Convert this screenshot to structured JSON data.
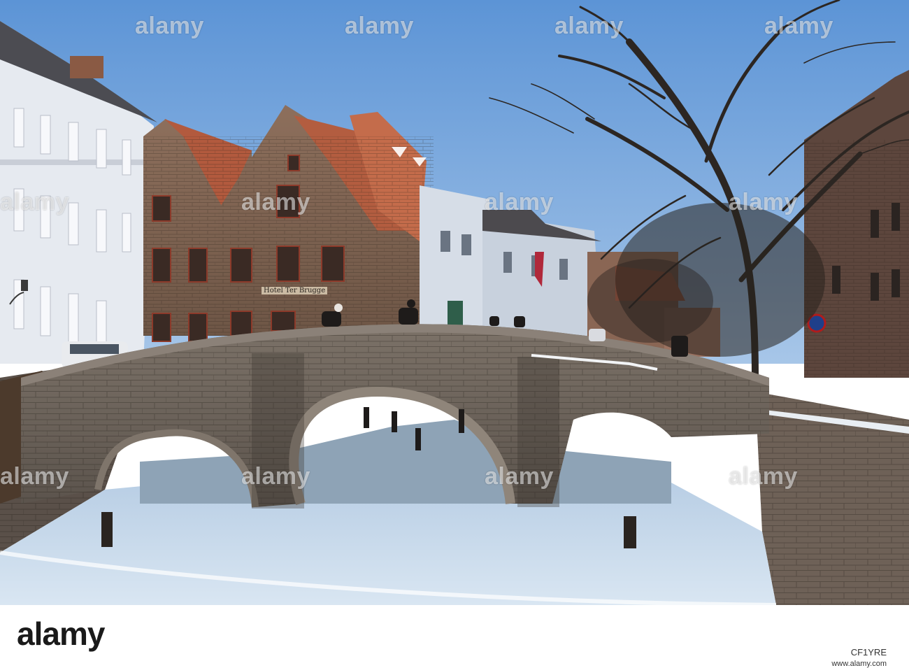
{
  "photo": {
    "watermark_text": "alamy",
    "hotel_sign_text": "Hotel Ter Brugge"
  },
  "footer": {
    "logo_text": "alamy",
    "image_id": "CF1YRE",
    "url": "www.alamy.com"
  }
}
